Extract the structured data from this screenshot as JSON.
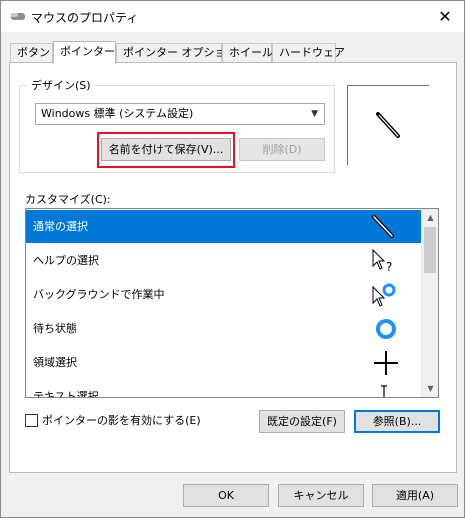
{
  "window": {
    "title": "マウスのプロパティ",
    "close_glyph": "✕"
  },
  "tabs": [
    {
      "label": "ボタン",
      "active": false
    },
    {
      "label": "ポインター",
      "active": true
    },
    {
      "label": "ポインター オプション",
      "active": false
    },
    {
      "label": "ホイール",
      "active": false
    },
    {
      "label": "ハードウェア",
      "active": false
    }
  ],
  "design": {
    "group_label": "デザイン(S)",
    "scheme_value": "Windows 標準 (システム設定)",
    "save_as_label": "名前を付けて保存(V)...",
    "delete_label": "削除(D)"
  },
  "customize": {
    "label": "カスタマイズ(C):",
    "items": [
      {
        "label": "通常の選択",
        "icon": "pen-cursor-icon",
        "selected": true
      },
      {
        "label": "ヘルプの選択",
        "icon": "help-cursor-icon",
        "selected": false
      },
      {
        "label": "バックグラウンドで作業中",
        "icon": "working-in-background-cursor-icon",
        "selected": false
      },
      {
        "label": "待ち状態",
        "icon": "busy-cursor-icon",
        "selected": false
      },
      {
        "label": "領域選択",
        "icon": "precision-cross-cursor-icon",
        "selected": false
      },
      {
        "label": "テキスト選択",
        "icon": "text-beam-cursor-icon",
        "selected": false
      }
    ]
  },
  "shadow_checkbox": {
    "label": "ポインターの影を有効にする(E)",
    "checked": false
  },
  "buttons": {
    "use_default": "既定の設定(F)",
    "browse": "参照(B)...",
    "ok": "OK",
    "cancel": "キャンセル",
    "apply": "適用(A)"
  },
  "colors": {
    "selection": "#0078d7",
    "highlight_box": "#e81123",
    "busy_ring": "#1e90ff"
  }
}
